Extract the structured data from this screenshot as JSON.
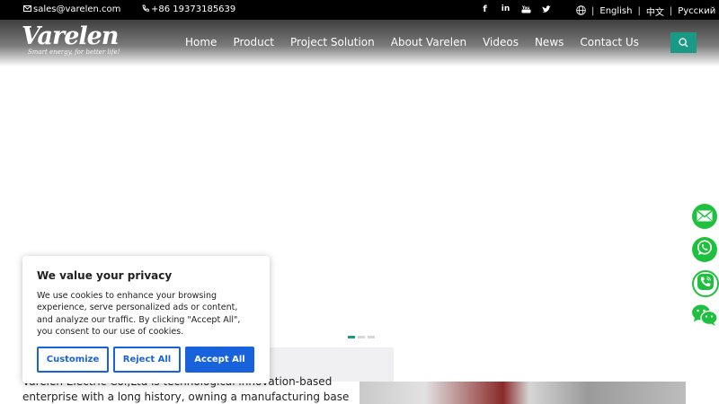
{
  "topbar": {
    "email": "sales@varelen.com",
    "phone": "+86 19373185639",
    "social_icons": [
      "facebook-icon",
      "linkedin-icon",
      "youtube-icon",
      "twitter-icon"
    ],
    "languages": [
      "English",
      "中文",
      "Русский"
    ],
    "separator": "|"
  },
  "header": {
    "logo_text": "Varelen",
    "logo_tagline": "Smart energy, for better life!",
    "nav": [
      "Home",
      "Product",
      "Project Solution",
      "About Varelen",
      "Videos",
      "News",
      "Contact Us"
    ],
    "search_icon": "search-icon"
  },
  "colors": {
    "accent": "#1a9a85",
    "cookie_blue": "#1863dc",
    "float_green": "#1fc03f"
  },
  "slider": {
    "total_slides": 3,
    "active_slide": 1
  },
  "intro": {
    "line1": "Varelen Electric Co.,Ltd is technological innovation-based",
    "line2": "enterprise with a long history, owning a manufacturing base in"
  },
  "floating_contacts": [
    "email-icon",
    "whatsapp-icon",
    "phone-icon",
    "wechat-icon"
  ],
  "cookie": {
    "title": "We value your privacy",
    "text": "We use cookies to enhance your browsing experience, serve personalized ads or content, and analyze our traffic. By clicking \"Accept All\", you consent to our use of cookies.",
    "customize": "Customize",
    "reject": "Reject All",
    "accept": "Accept All"
  }
}
